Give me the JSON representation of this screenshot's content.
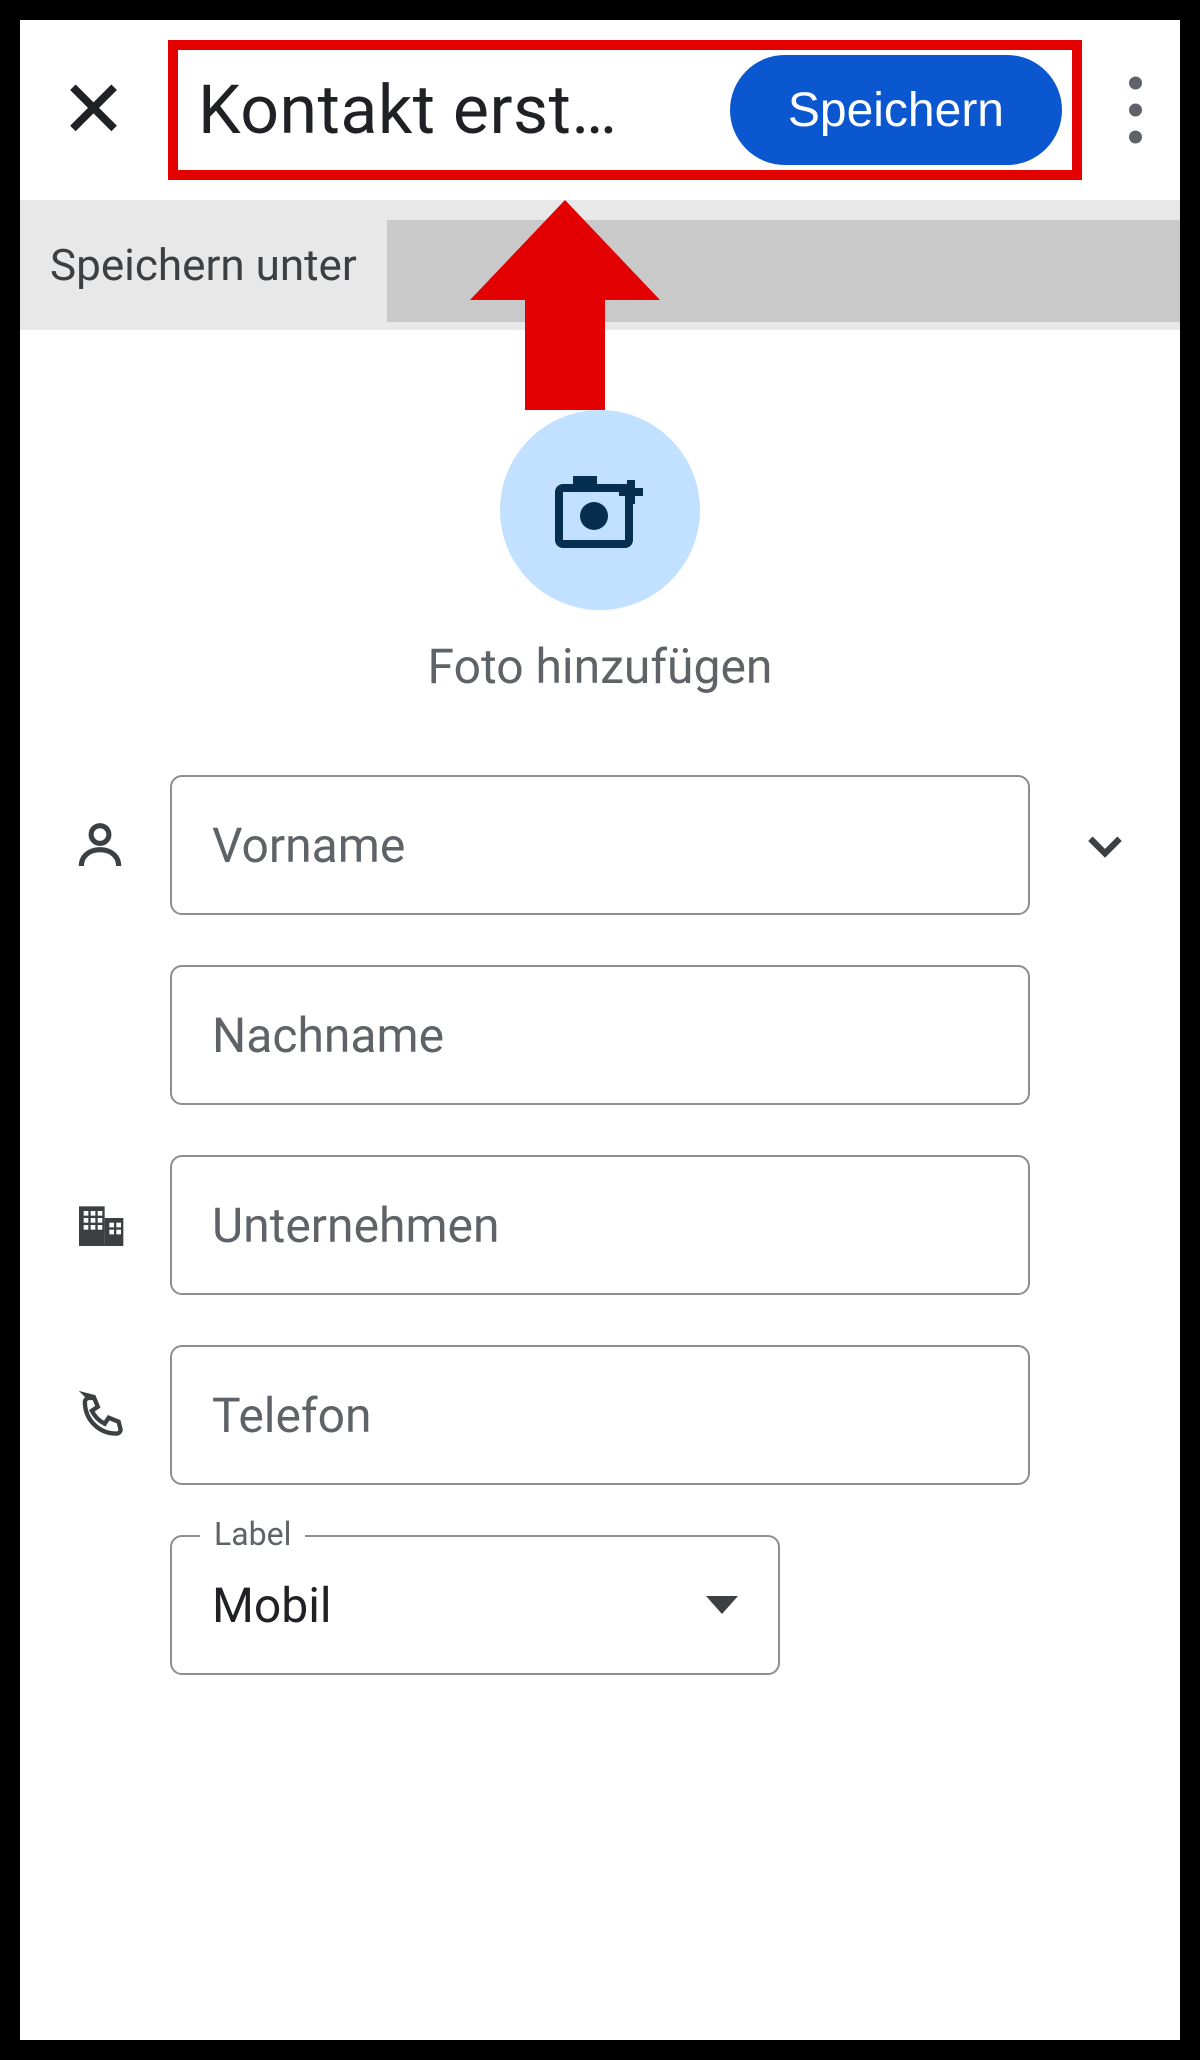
{
  "topbar": {
    "title": "Kontakt erst…",
    "save_label": "Speichern"
  },
  "save_under": {
    "label": "Speichern unter"
  },
  "photo": {
    "label": "Foto hinzufügen"
  },
  "fields": {
    "first_name_placeholder": "Vorname",
    "last_name_placeholder": "Nachname",
    "company_placeholder": "Unternehmen",
    "phone_placeholder": "Telefon",
    "phone_type_legend": "Label",
    "phone_type_value": "Mobil"
  }
}
